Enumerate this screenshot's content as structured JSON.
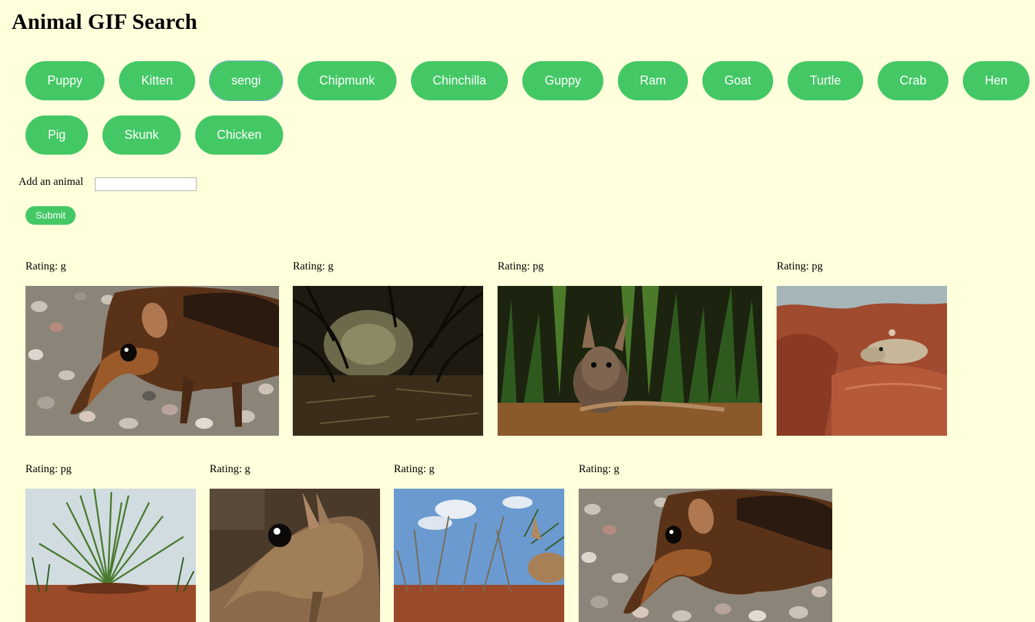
{
  "page": {
    "title": "Animal GIF Search"
  },
  "animals": [
    "Puppy",
    "Kitten",
    "sengi",
    "Chipmunk",
    "Chinchilla",
    "Guppy",
    "Ram",
    "Goat",
    "Turtle",
    "Crab",
    "Hen",
    "Pig",
    "Skunk",
    "Chicken"
  ],
  "form": {
    "label": "Add an animal",
    "input_value": "",
    "placeholder": "",
    "submit_label": "Submit"
  },
  "gifs": [
    {
      "rating": "Rating: g",
      "subject": "sengi on pebbles"
    },
    {
      "rating": "Rating: g",
      "subject": "dark undergrowth trail"
    },
    {
      "rating": "Rating: pg",
      "subject": "sengi in grass"
    },
    {
      "rating": "Rating: pg",
      "subject": "sengi on red rocks"
    },
    {
      "rating": "Rating: pg",
      "subject": "grass tuft on red soil"
    },
    {
      "rating": "Rating: g",
      "subject": "sengi close-up"
    },
    {
      "rating": "Rating: g",
      "subject": "sengi under blue sky"
    },
    {
      "rating": "Rating: g",
      "subject": "sengi on pebbles"
    }
  ],
  "colors": {
    "background": "#ffffdc",
    "button": "#44c865",
    "button_text": "#ffffff"
  }
}
